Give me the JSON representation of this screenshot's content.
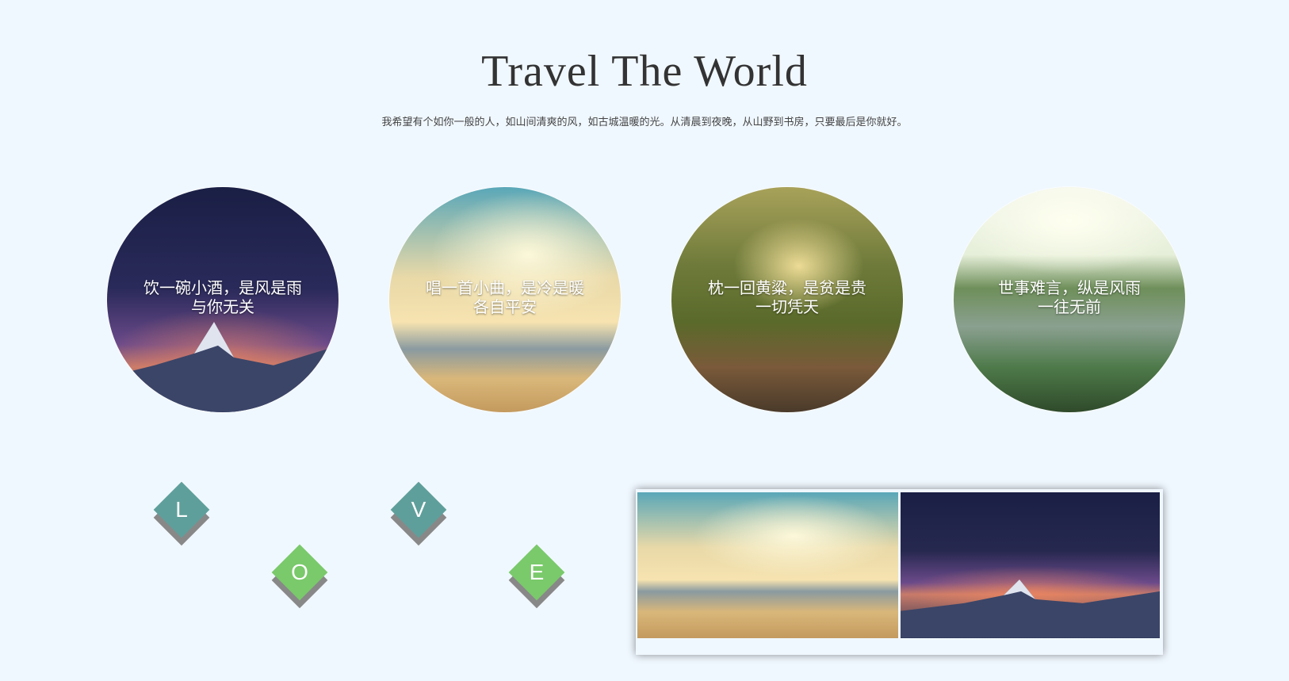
{
  "header": {
    "title": "Travel The World",
    "subtitle": "我希望有个如你一般的人，如山间清爽的风，如古城温暖的光。从清晨到夜晚，从山野到书房，只要最后是你就好。"
  },
  "circles": [
    {
      "line1": "饮一碗小酒，是风是雨",
      "line2": "与你无关"
    },
    {
      "line1": "唱一首小曲，是冷是暖",
      "line2": "各自平安"
    },
    {
      "line1": "枕一回黄粱，是贫是贵",
      "line2": "一切凭天"
    },
    {
      "line1": "世事难言，纵是风雨",
      "line2": "一往无前"
    }
  ],
  "love": [
    "L",
    "O",
    "V",
    "E"
  ],
  "colors": {
    "background": "#f0f8ff",
    "teal": "#5f9f9b",
    "green": "#7ac96b"
  }
}
